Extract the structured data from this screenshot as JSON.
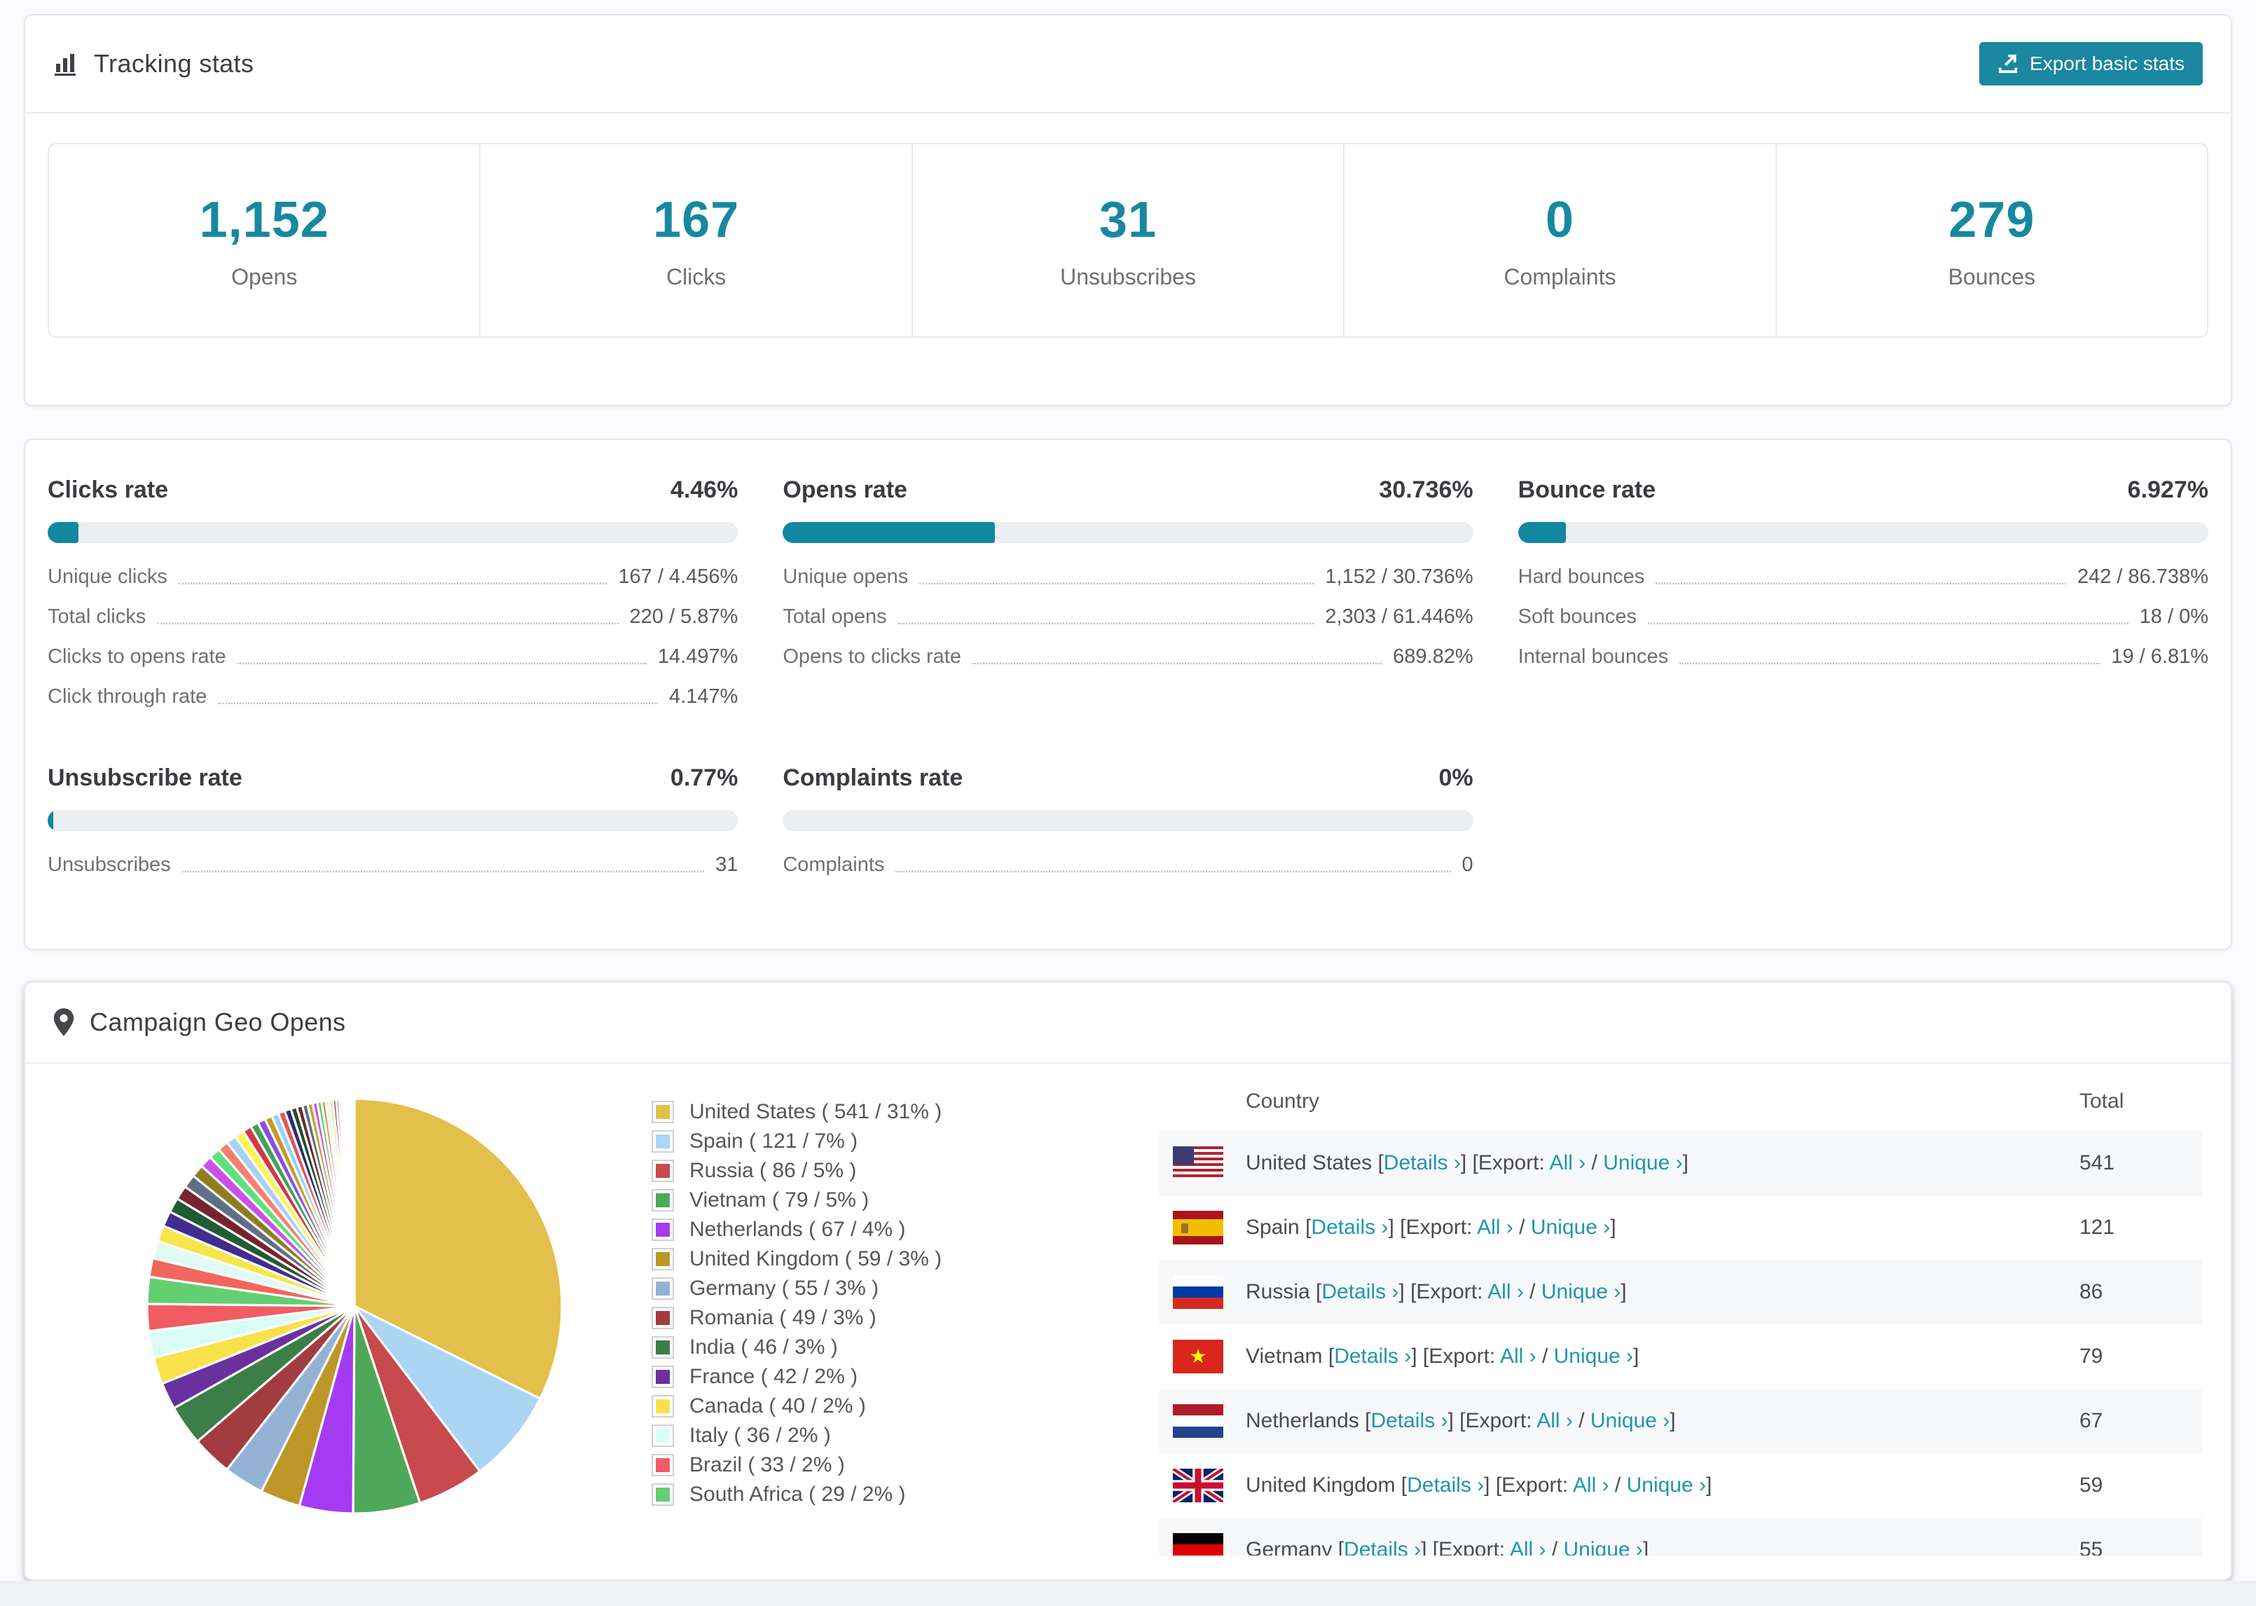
{
  "accent_color": "#1187a0",
  "link_color": "#2095ae",
  "tracking": {
    "title": "Tracking stats",
    "export_button": "Export basic stats",
    "stats": [
      {
        "value": "1,152",
        "label": "Opens"
      },
      {
        "value": "167",
        "label": "Clicks"
      },
      {
        "value": "31",
        "label": "Unsubscribes"
      },
      {
        "value": "0",
        "label": "Complaints"
      },
      {
        "value": "279",
        "label": "Bounces"
      }
    ]
  },
  "rates": {
    "blocks": [
      {
        "title": "Clicks rate",
        "value": "4.46%",
        "percent": 4.46,
        "rows": [
          [
            "Unique clicks",
            "167 / 4.456%"
          ],
          [
            "Total clicks",
            "220 / 5.87%"
          ],
          [
            "Clicks to opens rate",
            "14.497%"
          ],
          [
            "Click through rate",
            "4.147%"
          ]
        ]
      },
      {
        "title": "Opens rate",
        "value": "30.736%",
        "percent": 30.736,
        "rows": [
          [
            "Unique opens",
            "1,152 / 30.736%"
          ],
          [
            "Total opens",
            "2,303 / 61.446%"
          ],
          [
            "Opens to clicks rate",
            "689.82%"
          ]
        ]
      },
      {
        "title": "Bounce rate",
        "value": "6.927%",
        "percent": 6.927,
        "rows": [
          [
            "Hard bounces",
            "242 / 86.738%"
          ],
          [
            "Soft bounces",
            "18 / 0%"
          ],
          [
            "Internal bounces",
            "19 / 6.81%"
          ]
        ]
      },
      {
        "title": "Unsubscribe rate",
        "value": "0.77%",
        "percent": 0.77,
        "rows": [
          [
            "Unsubscribes",
            "31"
          ]
        ]
      },
      {
        "title": "Complaints rate",
        "value": "0%",
        "percent": 0,
        "rows": [
          [
            "Complaints",
            "0"
          ]
        ]
      }
    ]
  },
  "geo": {
    "title": "Campaign Geo Opens",
    "table_headers": {
      "country": "Country",
      "total": "Total"
    },
    "row_links": {
      "details": "Details ›",
      "export_label": "[Export: ",
      "all": "All ›",
      "separator": " / ",
      "unique": "Unique ›"
    },
    "visible_table_rows": 7,
    "countries": [
      {
        "name": "United States",
        "code": "us",
        "count": 541,
        "percent": 31,
        "color": "#E3C04B"
      },
      {
        "name": "Spain",
        "code": "es",
        "count": 121,
        "percent": 7,
        "color": "#ACD4F3"
      },
      {
        "name": "Russia",
        "code": "ru",
        "count": 86,
        "percent": 5,
        "color": "#C8494E"
      },
      {
        "name": "Vietnam",
        "code": "vn",
        "count": 79,
        "percent": 5,
        "color": "#4FA85A"
      },
      {
        "name": "Netherlands",
        "code": "nl",
        "count": 67,
        "percent": 4,
        "color": "#A43BF2"
      },
      {
        "name": "United Kingdom",
        "code": "gb",
        "count": 59,
        "percent": 3,
        "color": "#BD9727"
      },
      {
        "name": "Germany",
        "code": "de",
        "count": 55,
        "percent": 3,
        "color": "#93B2D4"
      },
      {
        "name": "Romania",
        "code": "ro",
        "count": 49,
        "percent": 3,
        "color": "#A23C40"
      },
      {
        "name": "India",
        "code": "in",
        "count": 46,
        "percent": 3,
        "color": "#3C7E47"
      },
      {
        "name": "France",
        "code": "fr",
        "count": 42,
        "percent": 2,
        "color": "#6B309F"
      },
      {
        "name": "Canada",
        "code": "ca",
        "count": 40,
        "percent": 2,
        "color": "#F8E14B"
      },
      {
        "name": "Italy",
        "code": "it",
        "count": 36,
        "percent": 2,
        "color": "#D9FDF6"
      },
      {
        "name": "Brazil",
        "code": "br",
        "count": 33,
        "percent": 2,
        "color": "#F15C63"
      },
      {
        "name": "South Africa",
        "code": "za",
        "count": 29,
        "percent": 2,
        "color": "#63CF71"
      }
    ]
  },
  "chart_data": {
    "type": "pie",
    "title": "Campaign Geo Opens",
    "labels": [
      "United States",
      "Spain",
      "Russia",
      "Vietnam",
      "Netherlands",
      "United Kingdom",
      "Germany",
      "Romania",
      "India",
      "France",
      "Canada",
      "Italy",
      "Brazil",
      "South Africa"
    ],
    "values": [
      541,
      121,
      86,
      79,
      67,
      59,
      55,
      49,
      46,
      42,
      40,
      36,
      33,
      29
    ],
    "percents": [
      31,
      7,
      5,
      5,
      4,
      3,
      3,
      3,
      3,
      2,
      2,
      2,
      2,
      2
    ],
    "colors": [
      "#E3C04B",
      "#ACD4F3",
      "#C8494E",
      "#4FA85A",
      "#A43BF2",
      "#BD9727",
      "#93B2D4",
      "#A23C40",
      "#3C7E47",
      "#6B309F",
      "#F8E14B",
      "#D9FDF6",
      "#F15C63",
      "#63CF71"
    ],
    "legend_labels": [
      "United States ( 541 / 31% )",
      "Spain ( 121 / 7% )",
      "Russia ( 86 / 5% )",
      "Vietnam ( 79 / 5% )",
      "Netherlands ( 67 / 4% )",
      "United Kingdom ( 59 / 3% )",
      "Germany ( 55 / 3% )",
      "Romania ( 49 / 3% )",
      "India ( 46 / 3% )",
      "France ( 42 / 2% )",
      "Canada ( 40 / 2% )",
      "Italy ( 36 / 2% )",
      "Brazil ( 33 / 2% )",
      "South Africa ( 29 / 2% )"
    ],
    "legend_position": "right",
    "start_angle_deg": -90,
    "others": {
      "values": [
        1.4,
        1.3,
        1.2,
        1.15,
        1.1,
        1.05,
        1.0,
        0.95,
        0.9,
        0.85,
        0.8,
        0.75,
        0.7,
        0.65,
        0.6,
        0.58,
        0.55,
        0.52,
        0.5,
        0.48,
        0.45,
        0.42,
        0.4,
        0.38,
        0.35,
        0.32,
        0.3,
        0.28,
        0.26,
        0.24,
        0.22,
        0.2,
        0.18,
        0.16,
        0.14,
        0.12,
        0.1,
        0.09,
        0.08,
        0.07
      ],
      "palette": [
        "#F2665E",
        "#DFFBF3",
        "#F6E64B",
        "#432B8F",
        "#1F5C33",
        "#76242E",
        "#5E7085",
        "#8F7D22",
        "#CC4FE8",
        "#5FE07E",
        "#F77E70",
        "#A9D2F2",
        "#FFF44F",
        "#CF3A45",
        "#3FA35C",
        "#8A4FE0",
        "#C79A1F",
        "#9AD0F5",
        "#E05656",
        "#2B2F6E",
        "#224D2B",
        "#6E2A2A",
        "#5C7185",
        "#BFA62F",
        "#E24FD0",
        "#49E06A",
        "#F97B6B",
        "#D8FBF0",
        "#F6E64B",
        "#5B2D91"
      ]
    }
  }
}
